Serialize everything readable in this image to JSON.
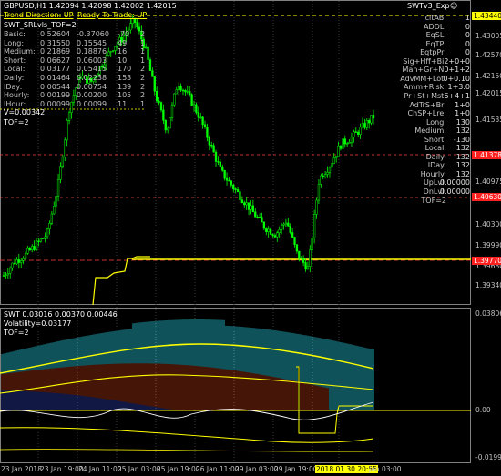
{
  "header": {
    "symbol_line": "GBPUSD,H1  1.42094 1.42098 1.42002 1.42015",
    "indicator_name": "SWTv3_Exp",
    "trend_direction": "Trend Direction:  UP",
    "ready_to_trade": "Ready To Trade:  UP",
    "srl_title": "SWT_SRLvls_TOF=2",
    "v_line": "V=0.00342",
    "tof_line": "TOF=2"
  },
  "info_table": [
    {
      "label": "Basic:",
      "a": "0.52604",
      "b": "-0.37060",
      "c": "-70",
      "d": "2"
    },
    {
      "label": "Long:",
      "a": "0.31550",
      "b": "0.15545",
      "c": "49",
      "d": "1"
    },
    {
      "label": "Medium:",
      "a": "0.21869",
      "b": "0.18876",
      "c": "16",
      "d": "1"
    },
    {
      "label": "Short:",
      "a": "0.06627",
      "b": "0.06003",
      "c": "10",
      "d": "1"
    },
    {
      "label": "Local:",
      "a": "0.03177",
      "b": "0.05415",
      "c": "170",
      "d": "2"
    },
    {
      "label": "Daily:",
      "a": "0.01464",
      "b": "0.02238",
      "c": "153",
      "d": "2"
    },
    {
      "label": "IDay:",
      "a": "0.00544",
      "b": "0.00754",
      "c": "139",
      "d": "2"
    },
    {
      "label": "Hourly:",
      "a": "0.00199",
      "b": "0.00200",
      "c": "105",
      "d": "2"
    },
    {
      "label": "IHour:",
      "a": "0.00099",
      "b": "0.00099",
      "c": "11",
      "d": "1"
    }
  ],
  "right_panel": [
    {
      "label": "IcitAB:",
      "value": "1"
    },
    {
      "label": "ADDL:",
      "value": "0"
    },
    {
      "label": "EqSL:",
      "value": "0"
    },
    {
      "label": "EqTP:",
      "value": "0"
    },
    {
      "label": "EqtpPr:",
      "value": "0"
    },
    {
      "label": "Sig+Hff+Bi:",
      "value": "2+0+0"
    },
    {
      "label": "Man+Gr+N:",
      "value": "0+1+2"
    },
    {
      "label": "AdvMM+Lot:",
      "value": "0+0.10"
    },
    {
      "label": "Amm+Risk:",
      "value": "1+3.0"
    },
    {
      "label": "Pr+St+Mst:",
      "value": "6+4+1"
    },
    {
      "label": "AdTrS+Br:",
      "value": "1+0"
    },
    {
      "label": "ChSP+Lre:",
      "value": "1+0"
    },
    {
      "label": "Long:",
      "value": "130"
    },
    {
      "label": "Medium:",
      "value": "132"
    },
    {
      "label": "Short:",
      "value": "-130"
    },
    {
      "label": "Local:",
      "value": "132"
    },
    {
      "label": "Daily:",
      "value": "132"
    },
    {
      "label": "IDay:",
      "value": "132"
    },
    {
      "label": "Hourly:",
      "value": "132"
    },
    {
      "label": "UpLvl:",
      "value": "0.00000"
    },
    {
      "label": "DnLvl:",
      "value": "0.00000"
    },
    {
      "label": "TOF=2",
      "value": ""
    }
  ],
  "price_axis": [
    "1.43440",
    "1.43005",
    "1.42570",
    "1.42150",
    "1.42015",
    "1.41535",
    "1.41378",
    "1.40975",
    "1.40630",
    "1.40300",
    "1.39990",
    "1.39770",
    "1.39680",
    "1.39340"
  ],
  "price_tags": {
    "top": "1.43440",
    "mid": "1.41378",
    "low": "1.40630",
    "bottom": "1.39770"
  },
  "sub_header": {
    "line1": "SWT 0.03016 0.00370 0.00446",
    "line2": "Volatility=0.03177",
    "line3": "TOF=2"
  },
  "sub_axis": [
    "0.03806",
    "0.00",
    "-0.01998"
  ],
  "time_axis": [
    "23 Jan 2018",
    "23 Jan 19:00",
    "24 Jan 11:00",
    "25 Jan 03:00",
    "25 Jan 19:00",
    "26 Jan 11:00",
    "29 Jan 03:00",
    "29 Jan 19:00",
    "2018.01.30 20:55",
    "Jan 03:00"
  ],
  "colors": {
    "bull": "#00ff00",
    "bear": "#00ff00",
    "accent_yellow": "#ffff00",
    "tag_red": "#ff0000",
    "hist_cyan": "#21a3b3",
    "hist_brown": "#8a2a10",
    "hist_navy": "#1f2f86",
    "grid": "#303030"
  },
  "chart_data": {
    "type": "candlestick",
    "title": "GBPUSD,H1",
    "x_range": [
      "23 Jan 2018",
      "30 Jan 2018"
    ],
    "ylim": [
      1.3934,
      1.4348
    ],
    "close_path": [
      1.397,
      1.399,
      1.4,
      1.4015,
      1.403,
      1.41,
      1.421,
      1.426,
      1.425,
      1.4275,
      1.43,
      1.4315,
      1.434,
      1.43,
      1.423,
      1.418,
      1.425,
      1.423,
      1.42,
      1.416,
      1.412,
      1.41,
      1.408,
      1.406,
      1.404,
      1.403,
      1.405,
      1.4,
      1.398,
      1.411,
      1.413,
      1.416,
      1.417,
      1.4185,
      1.42
    ]
  }
}
